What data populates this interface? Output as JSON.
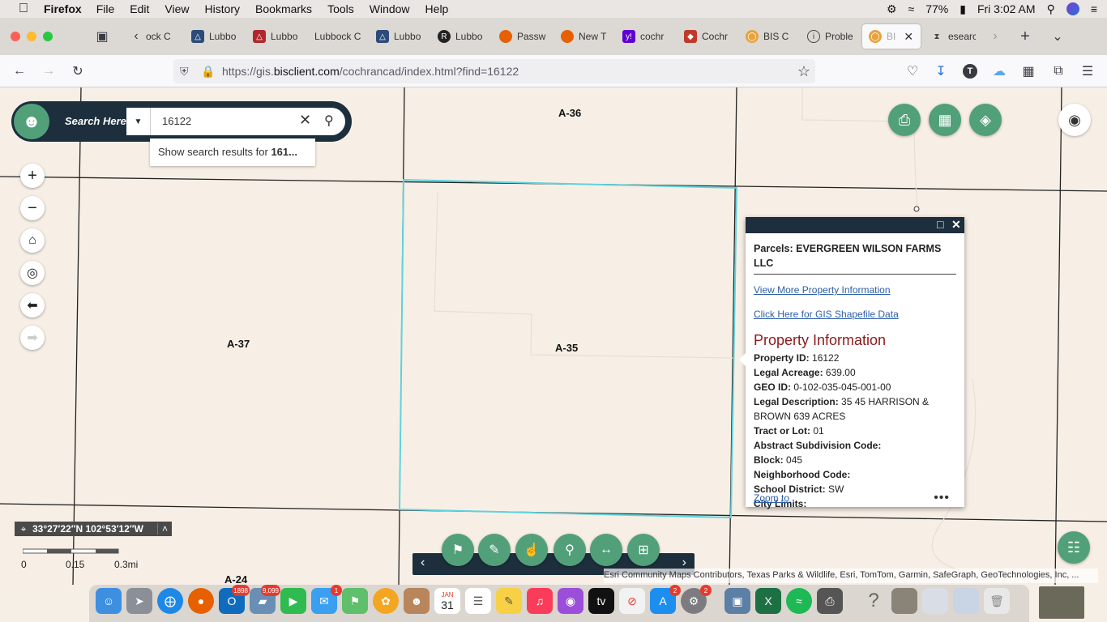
{
  "menubar": {
    "app_name": "Firefox",
    "items": [
      "File",
      "Edit",
      "View",
      "History",
      "Bookmarks",
      "Tools",
      "Window",
      "Help"
    ],
    "battery": "77%",
    "clock": "Fri 3:02 AM"
  },
  "tabs": [
    {
      "label": "ock C",
      "icon_color": "#888888"
    },
    {
      "label": "Lubbo",
      "icon_color": "#2b4b7a"
    },
    {
      "label": "Lubbo",
      "icon_color": "#b0282d"
    },
    {
      "label": "Lubbock C",
      "icon_color": ""
    },
    {
      "label": "Lubbo",
      "icon_color": "#2b4b7a"
    },
    {
      "label": "Lubbo",
      "icon_color": "#222222"
    },
    {
      "label": "Passw",
      "icon_color": "#e66000"
    },
    {
      "label": "New T",
      "icon_color": "#e66000"
    },
    {
      "label": "cochr",
      "icon_color": "#6001d2"
    },
    {
      "label": "Cochr",
      "icon_color": "#c0392b"
    },
    {
      "label": "BIS C",
      "icon_color": "#e8a33d"
    },
    {
      "label": "Proble",
      "icon_color": "#444444"
    },
    {
      "label": "BI",
      "icon_color": "#e8a33d"
    },
    {
      "label": "esearc",
      "icon_color": "#444444"
    }
  ],
  "url": {
    "prefix": "https://gis.",
    "host": "bisclient.com",
    "path": "/cochrancad/index.html?find=16122"
  },
  "search": {
    "label": "Search Here:",
    "value": "16122",
    "suggestion_prefix": "Show search results for ",
    "suggestion_bold": "161..."
  },
  "map_labels": {
    "a36": "A-36",
    "a37": "A-37",
    "a35": "A-35",
    "a24": "A-24"
  },
  "popup": {
    "title": "Parcels: EVERGREEN WILSON FARMS LLC",
    "link1": "View More Property Information",
    "link2": "Click Here for GIS Shapefile Data",
    "section": "Property Information",
    "fields": [
      {
        "label": "Property ID:",
        "value": " 16122"
      },
      {
        "label": "Legal Acreage:",
        "value": " 639.00"
      },
      {
        "label": "GEO ID:",
        "value": " 0-102-035-045-001-00"
      },
      {
        "label": "Legal Description:",
        "value": " 35 45 HARRISON & BROWN 639 ACRES"
      },
      {
        "label": "Tract or Lot:",
        "value": " 01"
      },
      {
        "label": "Abstract Subdivision Code:",
        "value": ""
      },
      {
        "label": "Block:",
        "value": " 045"
      },
      {
        "label": "Neighborhood Code:",
        "value": ""
      },
      {
        "label": "School District:",
        "value": " SW"
      },
      {
        "label": "City Limits:",
        "value": ""
      }
    ],
    "zoom": "Zoom to",
    "more": "•••"
  },
  "coords": "33°27′22″N 102°53′12″W",
  "scale": {
    "zero": "0",
    "mid": "0.15",
    "end": "0.3mi"
  },
  "attribution": "Esri Community Maps Contributors, Texas Parks & Wildlife, Esri, TomTom, Garmin, SafeGraph, GeoTechnologies, Inc, ...",
  "dock": {
    "badges": {
      "outlook": "1898",
      "preview": "9,099",
      "messages": "1",
      "appstore": "2",
      "settings": "2"
    },
    "calendar_month": "JAN",
    "calendar_day": "31"
  },
  "colors": {
    "accent_green": "#52a07a",
    "navy": "#1d2e3d",
    "parcel_highlight": "#5fd3dd",
    "section_red": "#8b1a1a"
  }
}
